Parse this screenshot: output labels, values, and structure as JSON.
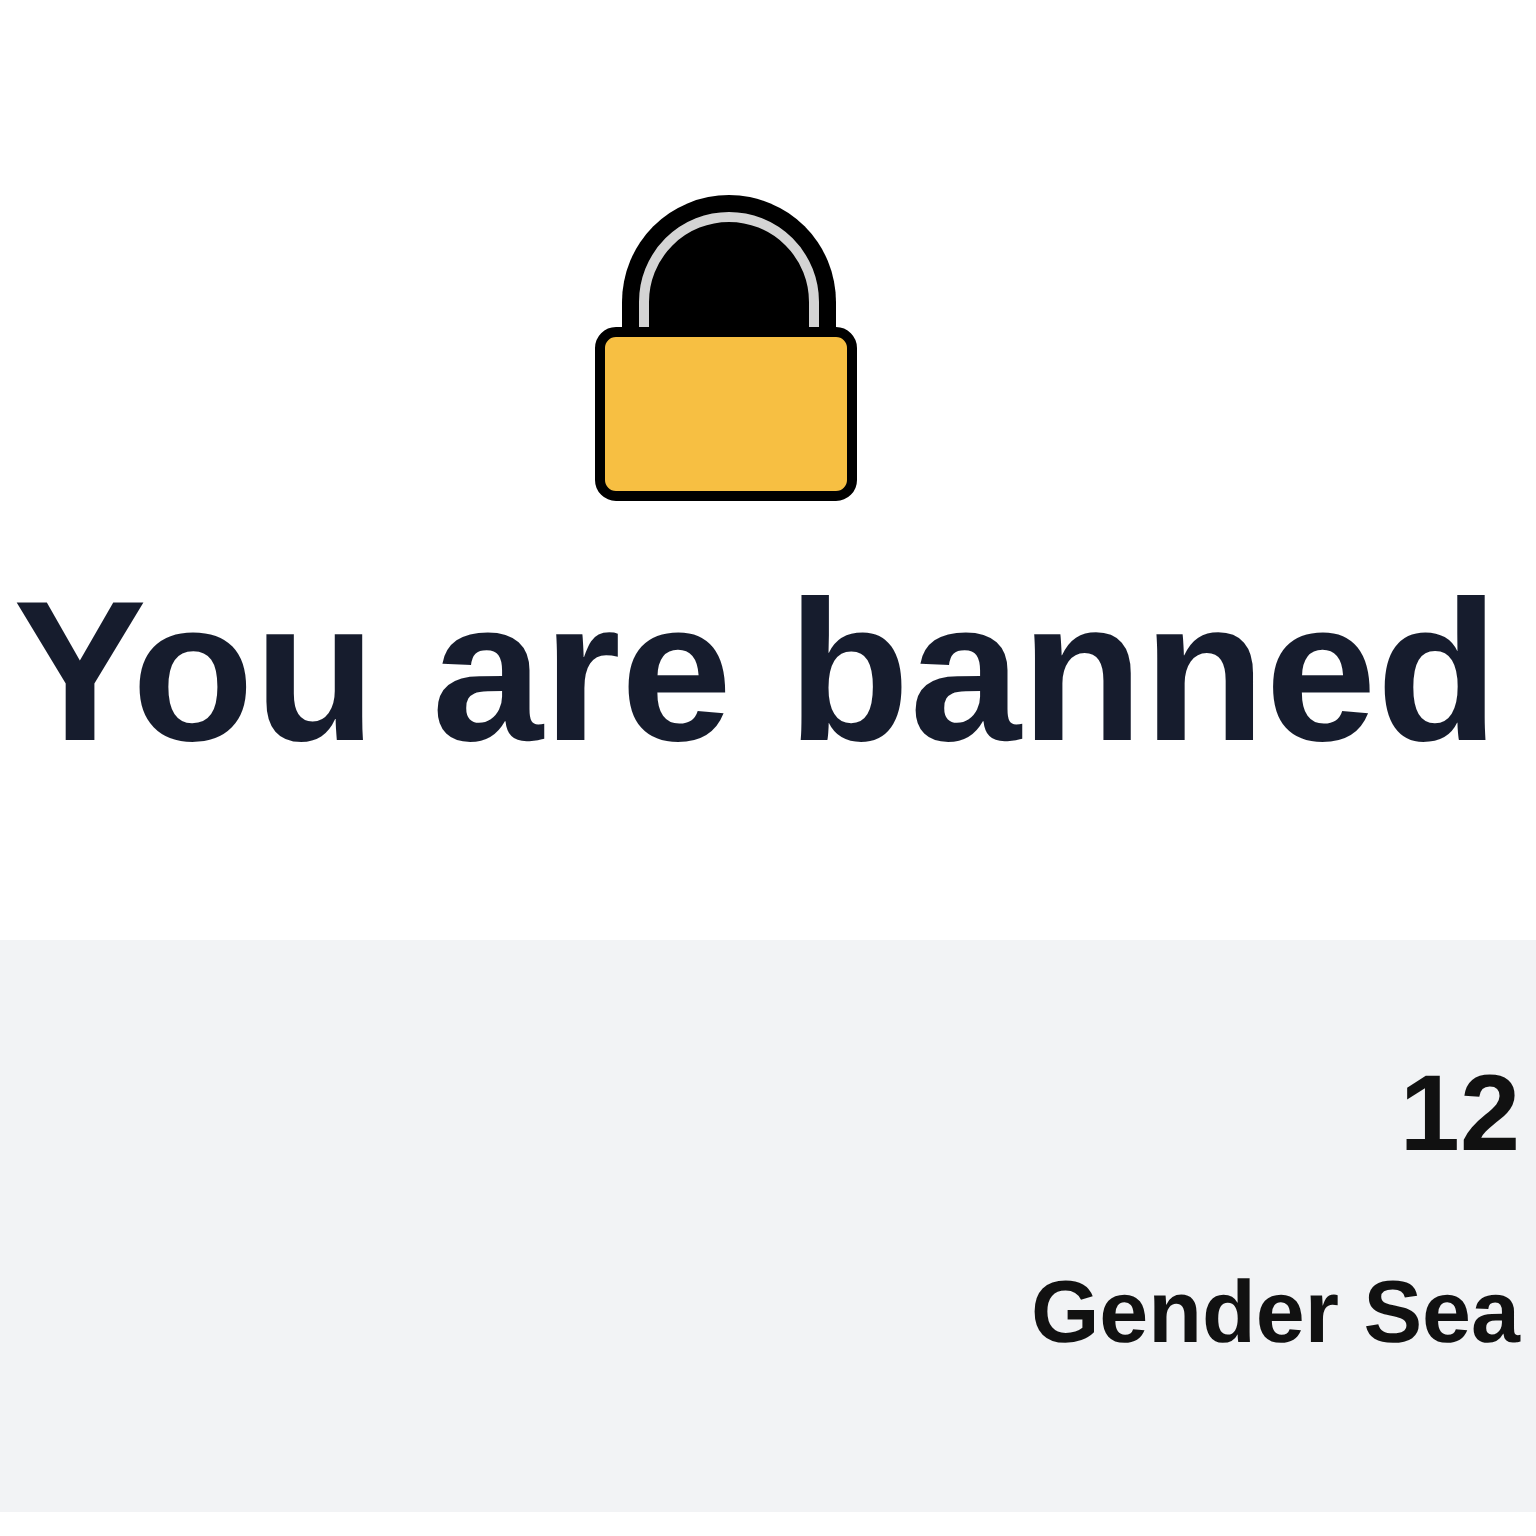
{
  "title": "You are banned",
  "info_panel": {
    "lines": [
      "12",
      "Gender Sea"
    ]
  }
}
